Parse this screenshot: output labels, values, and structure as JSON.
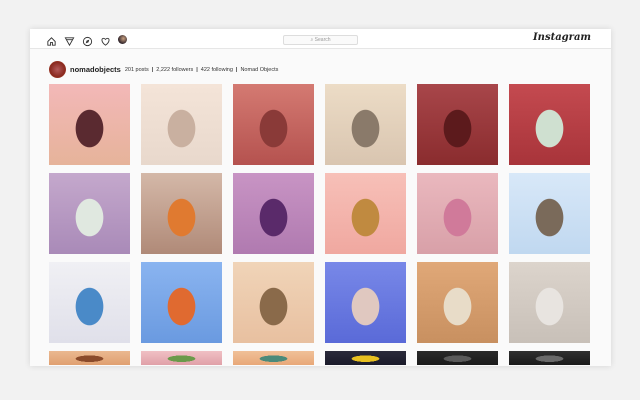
{
  "header": {
    "search_placeholder": "Search",
    "logo": "Instagram",
    "icons": [
      "home-icon",
      "direct-icon",
      "explore-icon",
      "heart-icon",
      "profile-avatar"
    ]
  },
  "profile": {
    "username": "nomadobjects",
    "posts": "201 posts",
    "followers": "2,222 followers",
    "following": "422 following",
    "name": "Nomad Objects"
  },
  "tiles": [
    [
      "#e6b39a",
      "#f3b8b8",
      "#5a2a30"
    ],
    [
      "#e8d8cc",
      "#f4e4d8",
      "#c9b0a0"
    ],
    [
      "#b5524f",
      "#d47a72",
      "#8a3a38"
    ],
    [
      "#d9c5b0",
      "#ecdcc6",
      "#8a7a6a"
    ],
    [
      "#8a2c2e",
      "#a8464a",
      "#5c1a1c"
    ],
    [
      "#a8343a",
      "#c44a50",
      "#cfe0d0"
    ],
    [
      "#a98ab8",
      "#c4a8cc",
      "#e0e8e0"
    ],
    [
      "#b08a78",
      "#d4b8a8",
      "#e07a30"
    ],
    [
      "#b07ab0",
      "#c894c4",
      "#5a2a6a"
    ],
    [
      "#f0a8a0",
      "#f7c0b8",
      "#c08a40"
    ],
    [
      "#d8a0a8",
      "#eab8be",
      "#d07a9a"
    ],
    [
      "#c0d8f0",
      "#d8e8f8",
      "#7a6a5a"
    ],
    [
      "#e0e0ea",
      "#f0f0f4",
      "#4a8ac8"
    ],
    [
      "#6a9ae0",
      "#8ab4f0",
      "#e06a30"
    ],
    [
      "#e8c0a0",
      "#f0d4b8",
      "#8a6a4a"
    ],
    [
      "#5a6ad8",
      "#7888e8",
      "#e0c8c0"
    ],
    [
      "#c89060",
      "#e0a878",
      "#e8dcc8"
    ],
    [
      "#c8c0b8",
      "#dcd4cc",
      "#e8e4e0"
    ],
    [
      "#e0a070",
      "#eab890",
      "#8a4a2a"
    ],
    [
      "#e0a0a8",
      "#f0c0c4",
      "#6a9a4a"
    ],
    [
      "#e8a878",
      "#f0c098",
      "#4a8a7a"
    ],
    [
      "#1a1a2a",
      "#2a2a3a",
      "#e8c020"
    ],
    [
      "#1a1a1a",
      "#2a2a2a",
      "#5a5a5a"
    ],
    [
      "#1a1a1a",
      "#303030",
      "#6a6a6a"
    ]
  ]
}
